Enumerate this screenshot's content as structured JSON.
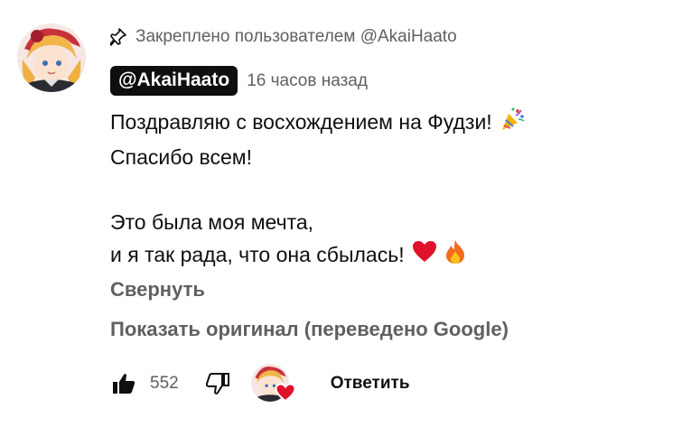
{
  "pinned": {
    "icon": "pin-icon",
    "text": "Закреплено пользователем @AkaiHaato"
  },
  "comment": {
    "author": "@AkaiHaato",
    "timestamp": "16 часов назад",
    "lines": [
      "Поздравляю с восхождением на Фудзи!",
      "Спасибо всем!",
      "",
      "Это была моя мечта,",
      "и я так рада, что она сбылась!"
    ],
    "emoji": {
      "line1": "party-popper-icon",
      "line5": [
        "red-heart-icon",
        "fire-icon"
      ]
    }
  },
  "links": {
    "collapse": "Свернуть",
    "show_original": "Показать оригинал (переведено Google)"
  },
  "actions": {
    "like_icon": "thumbs-up-icon",
    "like_count": "552",
    "dislike_icon": "thumbs-down-icon",
    "creator_heart_icon": "creator-heart-icon",
    "reply_label": "Ответить"
  },
  "colors": {
    "text": "#0f0f0f",
    "secondary": "#606060",
    "badge_bg": "#0f0f0f",
    "heart": "#e0112b"
  }
}
